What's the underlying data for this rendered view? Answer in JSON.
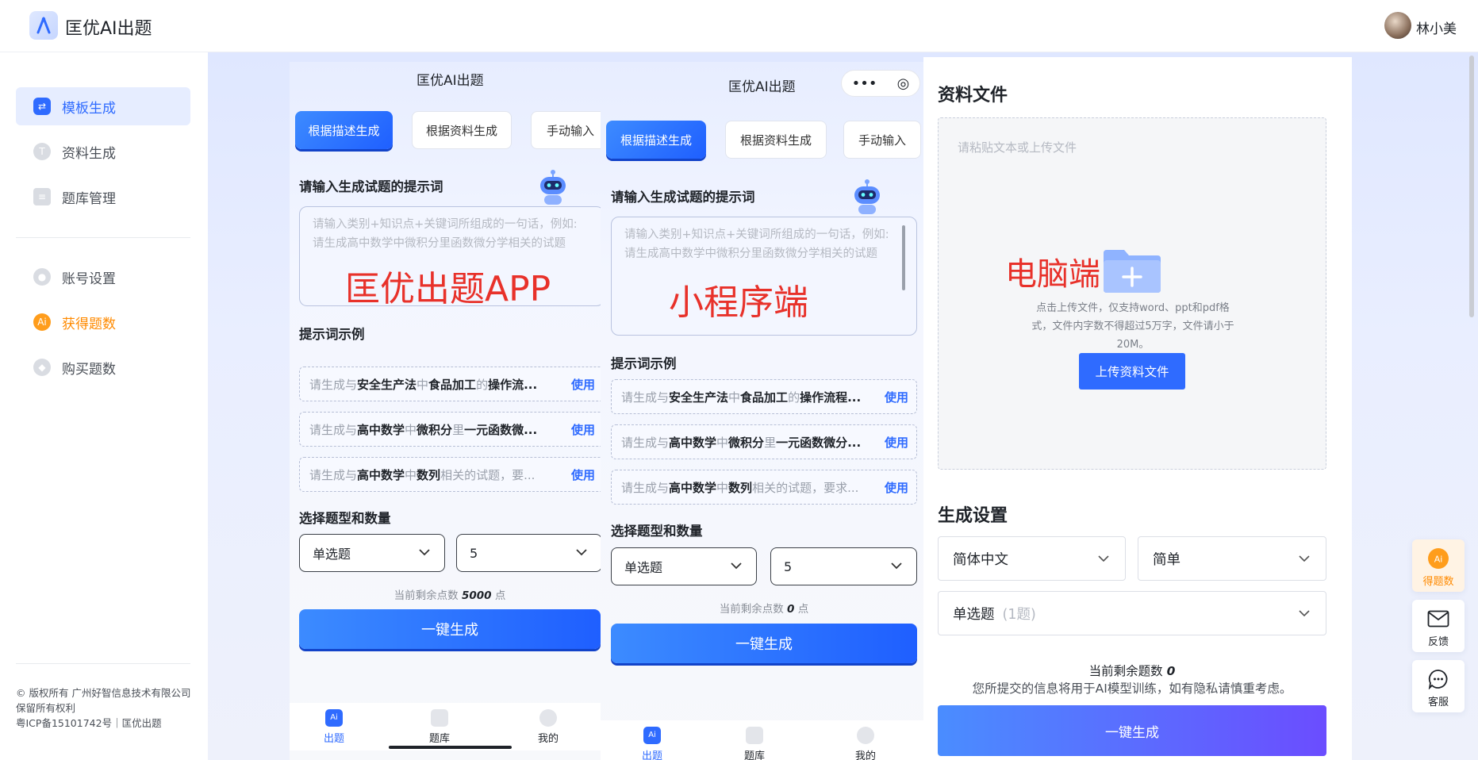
{
  "header": {
    "app_title": "匡优AI出题",
    "username": "林小美"
  },
  "sidebar": {
    "items": [
      {
        "label": "模板生成",
        "icon": "template-icon"
      },
      {
        "label": "资料生成",
        "icon": "document-icon"
      },
      {
        "label": "题库管理",
        "icon": "question-bank-icon"
      },
      {
        "label": "账号设置",
        "icon": "user-icon"
      },
      {
        "label": "获得题数",
        "icon": "ai-coin-icon"
      },
      {
        "label": "购买题数",
        "icon": "diamond-icon"
      }
    ],
    "footer": {
      "line1": "© 版权所有 广州好智信息技术有限公司",
      "line2": "保留所有权利",
      "line3": "粤ICP备15101742号｜匡优出题"
    }
  },
  "app_panel": {
    "title": "匡优AI出题",
    "tabs": [
      "根据描述生成",
      "根据资料生成",
      "手动输入"
    ],
    "prompt_title": "请输入生成试题的提示词",
    "prompt_placeholder": "请输入类别+知识点+关键词所组成的一句话，例如: 请生成高中数学中微积分里函数微分学相关的试题",
    "overlay_label": "匡优出题APP",
    "examples_title": "提示词示例",
    "examples": [
      {
        "p1": "请生成与",
        "b1": "安全生产法",
        "p2": "中",
        "b2": "食品加工",
        "p3": "的",
        "b3": "操作流...",
        "use": "使用"
      },
      {
        "p1": "请生成与",
        "b1": "高中数学",
        "p2": "中",
        "b2": "微积分",
        "p3": "里",
        "b3": "一元函数微...",
        "use": "使用"
      },
      {
        "p1": "请生成与",
        "b1": "高中数学",
        "p2": "中",
        "b2": "数列",
        "p3": "相关的试题，要...",
        "b3": "",
        "use": "使用"
      }
    ],
    "type_title": "选择题型和数量",
    "type_value": "单选题",
    "count_value": "5",
    "points_prefix": "当前剩余点数",
    "points_value": "5000",
    "points_suffix": "点",
    "generate": "一键生成",
    "nav": [
      "出题",
      "题库",
      "我的"
    ]
  },
  "mini_panel": {
    "title": "匡优AI出题",
    "capsule_more": "•••",
    "capsule_close": "◎",
    "tabs": [
      "根据描述生成",
      "根据资料生成",
      "手动输入"
    ],
    "prompt_title": "请输入生成试题的提示词",
    "prompt_placeholder": "请输入类别+知识点+关键词所组成的一句话，例如: 请生成高中数学中微积分里函数微分学相关的试题",
    "overlay_label": "小程序端",
    "examples_title": "提示词示例",
    "examples": [
      {
        "p1": "请生成与",
        "b1": "安全生产法",
        "p2": "中",
        "b2": "食品加工",
        "p3": "的",
        "b3": "操作流程...",
        "use": "使用"
      },
      {
        "p1": "请生成与",
        "b1": "高中数学",
        "p2": "中",
        "b2": "微积分",
        "p3": "里",
        "b3": "一元函数微分...",
        "use": "使用"
      },
      {
        "p1": "请生成与",
        "b1": "高中数学",
        "p2": "中",
        "b2": "数列",
        "p3": "相关的试题，要求...",
        "b3": "",
        "use": "使用"
      }
    ],
    "type_title": "选择题型和数量",
    "type_value": "单选题",
    "count_value": "5",
    "points_prefix": "当前剩余点数",
    "points_value": "0",
    "points_suffix": "点",
    "generate": "一键生成",
    "nav": [
      "出题",
      "题库",
      "我的"
    ]
  },
  "desktop_panel": {
    "files_title": "资料文件",
    "upload_placeholder": "请粘贴文本或上传文件",
    "overlay_label": "电脑端",
    "upload_hint": "点击上传文件，仅支持word、ppt和pdf格式，文件内字数不得超过5万字，文件请小于 20M。",
    "upload_button": "上传资料文件",
    "settings_title": "生成设置",
    "language": "简体中文",
    "difficulty": "简单",
    "question_type": "单选题",
    "question_count": "(1题)",
    "remain_prefix": "当前剩余题数",
    "remain_value": "0",
    "privacy": "您所提交的信息将用于AI模型训练，如有隐私请慎重考虑。",
    "generate": "一键生成"
  },
  "float_buttons": {
    "earn": "得题数",
    "feedback": "反馈",
    "service": "客服"
  },
  "colors": {
    "accent": "#2f6bff",
    "orange": "#ff8a00",
    "overlay_red": "#e8312a"
  }
}
